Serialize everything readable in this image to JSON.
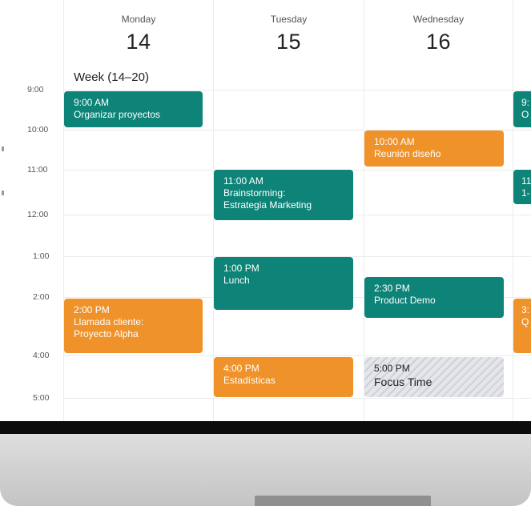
{
  "calendar": {
    "week_label": "Week (14–20)",
    "days": [
      {
        "name": "Monday",
        "number": "14"
      },
      {
        "name": "Tuesday",
        "number": "15"
      },
      {
        "name": "Wednesday",
        "number": "16"
      }
    ],
    "times": [
      "9:00",
      "10:00",
      "11:00",
      "12:00",
      "1:00",
      "2:00",
      "4:00",
      "5:00"
    ],
    "events": [
      {
        "time": "9:00 AM",
        "title": "Organizar proyectos",
        "color": "#0e8478"
      },
      {
        "time": "10:00 AM",
        "title": "Reunión diseño",
        "color": "#ef922a"
      },
      {
        "time": "11:00 AM",
        "title_line1": "Brainstorming:",
        "title_line2": "Estrategia Marketing",
        "color": "#0e8478"
      },
      {
        "time": "1:00 PM",
        "title": "Lunch",
        "color": "#0e8478"
      },
      {
        "time": "2:30 PM",
        "title": "Product Demo",
        "color": "#0e8478"
      },
      {
        "time": "2:00 PM",
        "title_line1": "Llamada cliente:",
        "title_line2": "Proyecto Alpha",
        "color": "#ef922a"
      },
      {
        "time": "4:00 PM",
        "title": "Estadísticas",
        "color": "#ef922a"
      },
      {
        "time": "5:00 PM",
        "title": "Focus Time",
        "color": "#d8dbe0"
      }
    ],
    "clipped_events": [
      {
        "line1": "9:",
        "line2": "O",
        "color": "#0e8478"
      },
      {
        "line1": "11",
        "line2": "1-",
        "color": "#0e8478"
      },
      {
        "line1": "3:",
        "line2": "Q",
        "color": "#ef922a"
      }
    ]
  }
}
